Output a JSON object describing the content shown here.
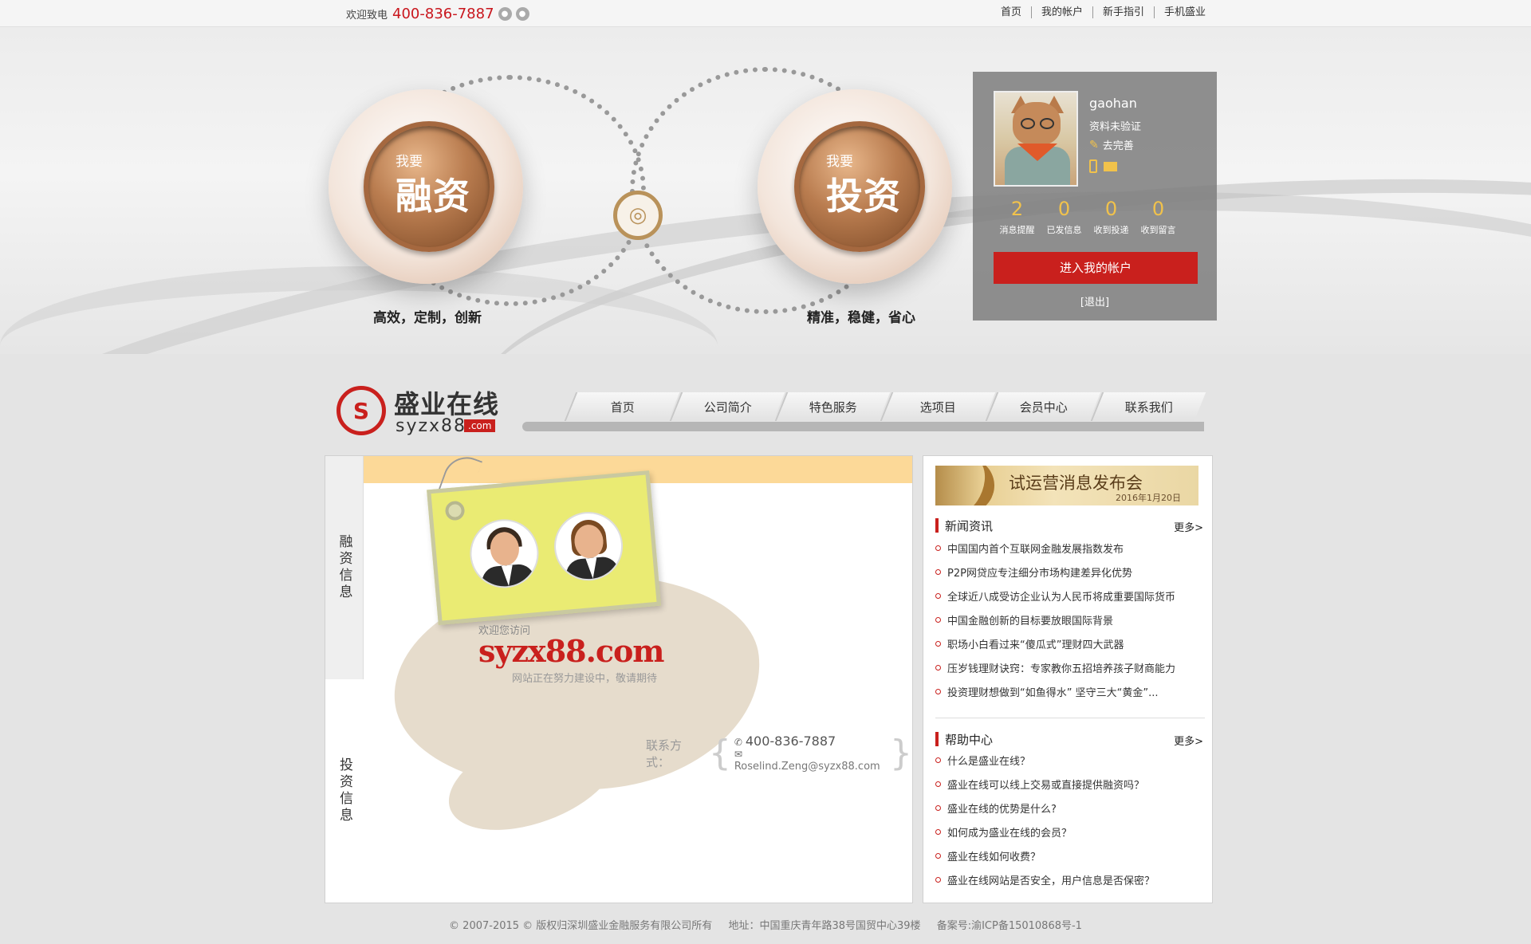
{
  "topbar": {
    "welcome": "欢迎致电",
    "phone": "400-836-7887",
    "icons": [
      "wechat-icon",
      "qq-icon"
    ],
    "links": [
      "首页",
      "我的帐户",
      "新手指引",
      "手机盛业"
    ]
  },
  "hero": {
    "left_medal": {
      "small": "我要",
      "big": "融资",
      "slogan": "高效，定制，创新"
    },
    "right_medal": {
      "small": "我要",
      "big": "投资",
      "slogan": "精准，稳健，省心"
    }
  },
  "user": {
    "username": "gaohan",
    "status": "资料未验证",
    "complete_link": "去完善",
    "stats": [
      {
        "value": "2",
        "label": "消息提醒"
      },
      {
        "value": "0",
        "label": "已发信息"
      },
      {
        "value": "0",
        "label": "收到投递"
      },
      {
        "value": "0",
        "label": "收到留言"
      }
    ],
    "enter_button": "进入我的帐户",
    "logout": "[退出]"
  },
  "logo": {
    "cn": "盛业在线",
    "en": "syzx88",
    "com": ".com"
  },
  "nav": {
    "items": [
      "首页",
      "公司简介",
      "特色服务",
      "选项目",
      "会员中心",
      "联系我们"
    ]
  },
  "left_panel": {
    "side_tabs": [
      "融资信息",
      "投资信息"
    ],
    "welcome": "欢迎您访问",
    "brand": "syzx88.com",
    "building": "网站正在努力建设中，敬请期待",
    "contact_label": "联系方式：",
    "contact_phone": "400-836-7887",
    "contact_email": "Roselind.Zeng@syzx88.com"
  },
  "right_panel": {
    "banner_title": "试运营消息发布会",
    "banner_date": "2016年1月20日",
    "news": {
      "title": "新闻资讯",
      "more": "更多>",
      "items": [
        "中国国内首个互联网金融发展指数发布",
        "P2P网贷应专注细分市场构建差异化优势",
        "全球近八成受访企业认为人民币将成重要国际货币",
        "中国金融创新的目标要放眼国际背景",
        "职场小白看过来“傻瓜式”理财四大武器",
        "压岁钱理财诀窍：专家教你五招培养孩子财商能力",
        "投资理财想做到“如鱼得水” 坚守三大“黄金”..."
      ]
    },
    "help": {
      "title": "帮助中心",
      "more": "更多>",
      "items": [
        "什么是盛业在线？",
        "盛业在线可以线上交易或直接提供融资吗？",
        "盛业在线的优势是什么?",
        "如何成为盛业在线的会员？",
        "盛业在线如何收费？",
        "盛业在线网站是否安全，用户信息是否保密？"
      ]
    }
  },
  "footer": {
    "copyright": "© 2007-2015 © 版权归深圳盛业金融服务有限公司所有",
    "address": "地址：中国重庆青年路38号国贸中心39楼",
    "icp": "备案号:渝ICP备15010868号-1"
  }
}
